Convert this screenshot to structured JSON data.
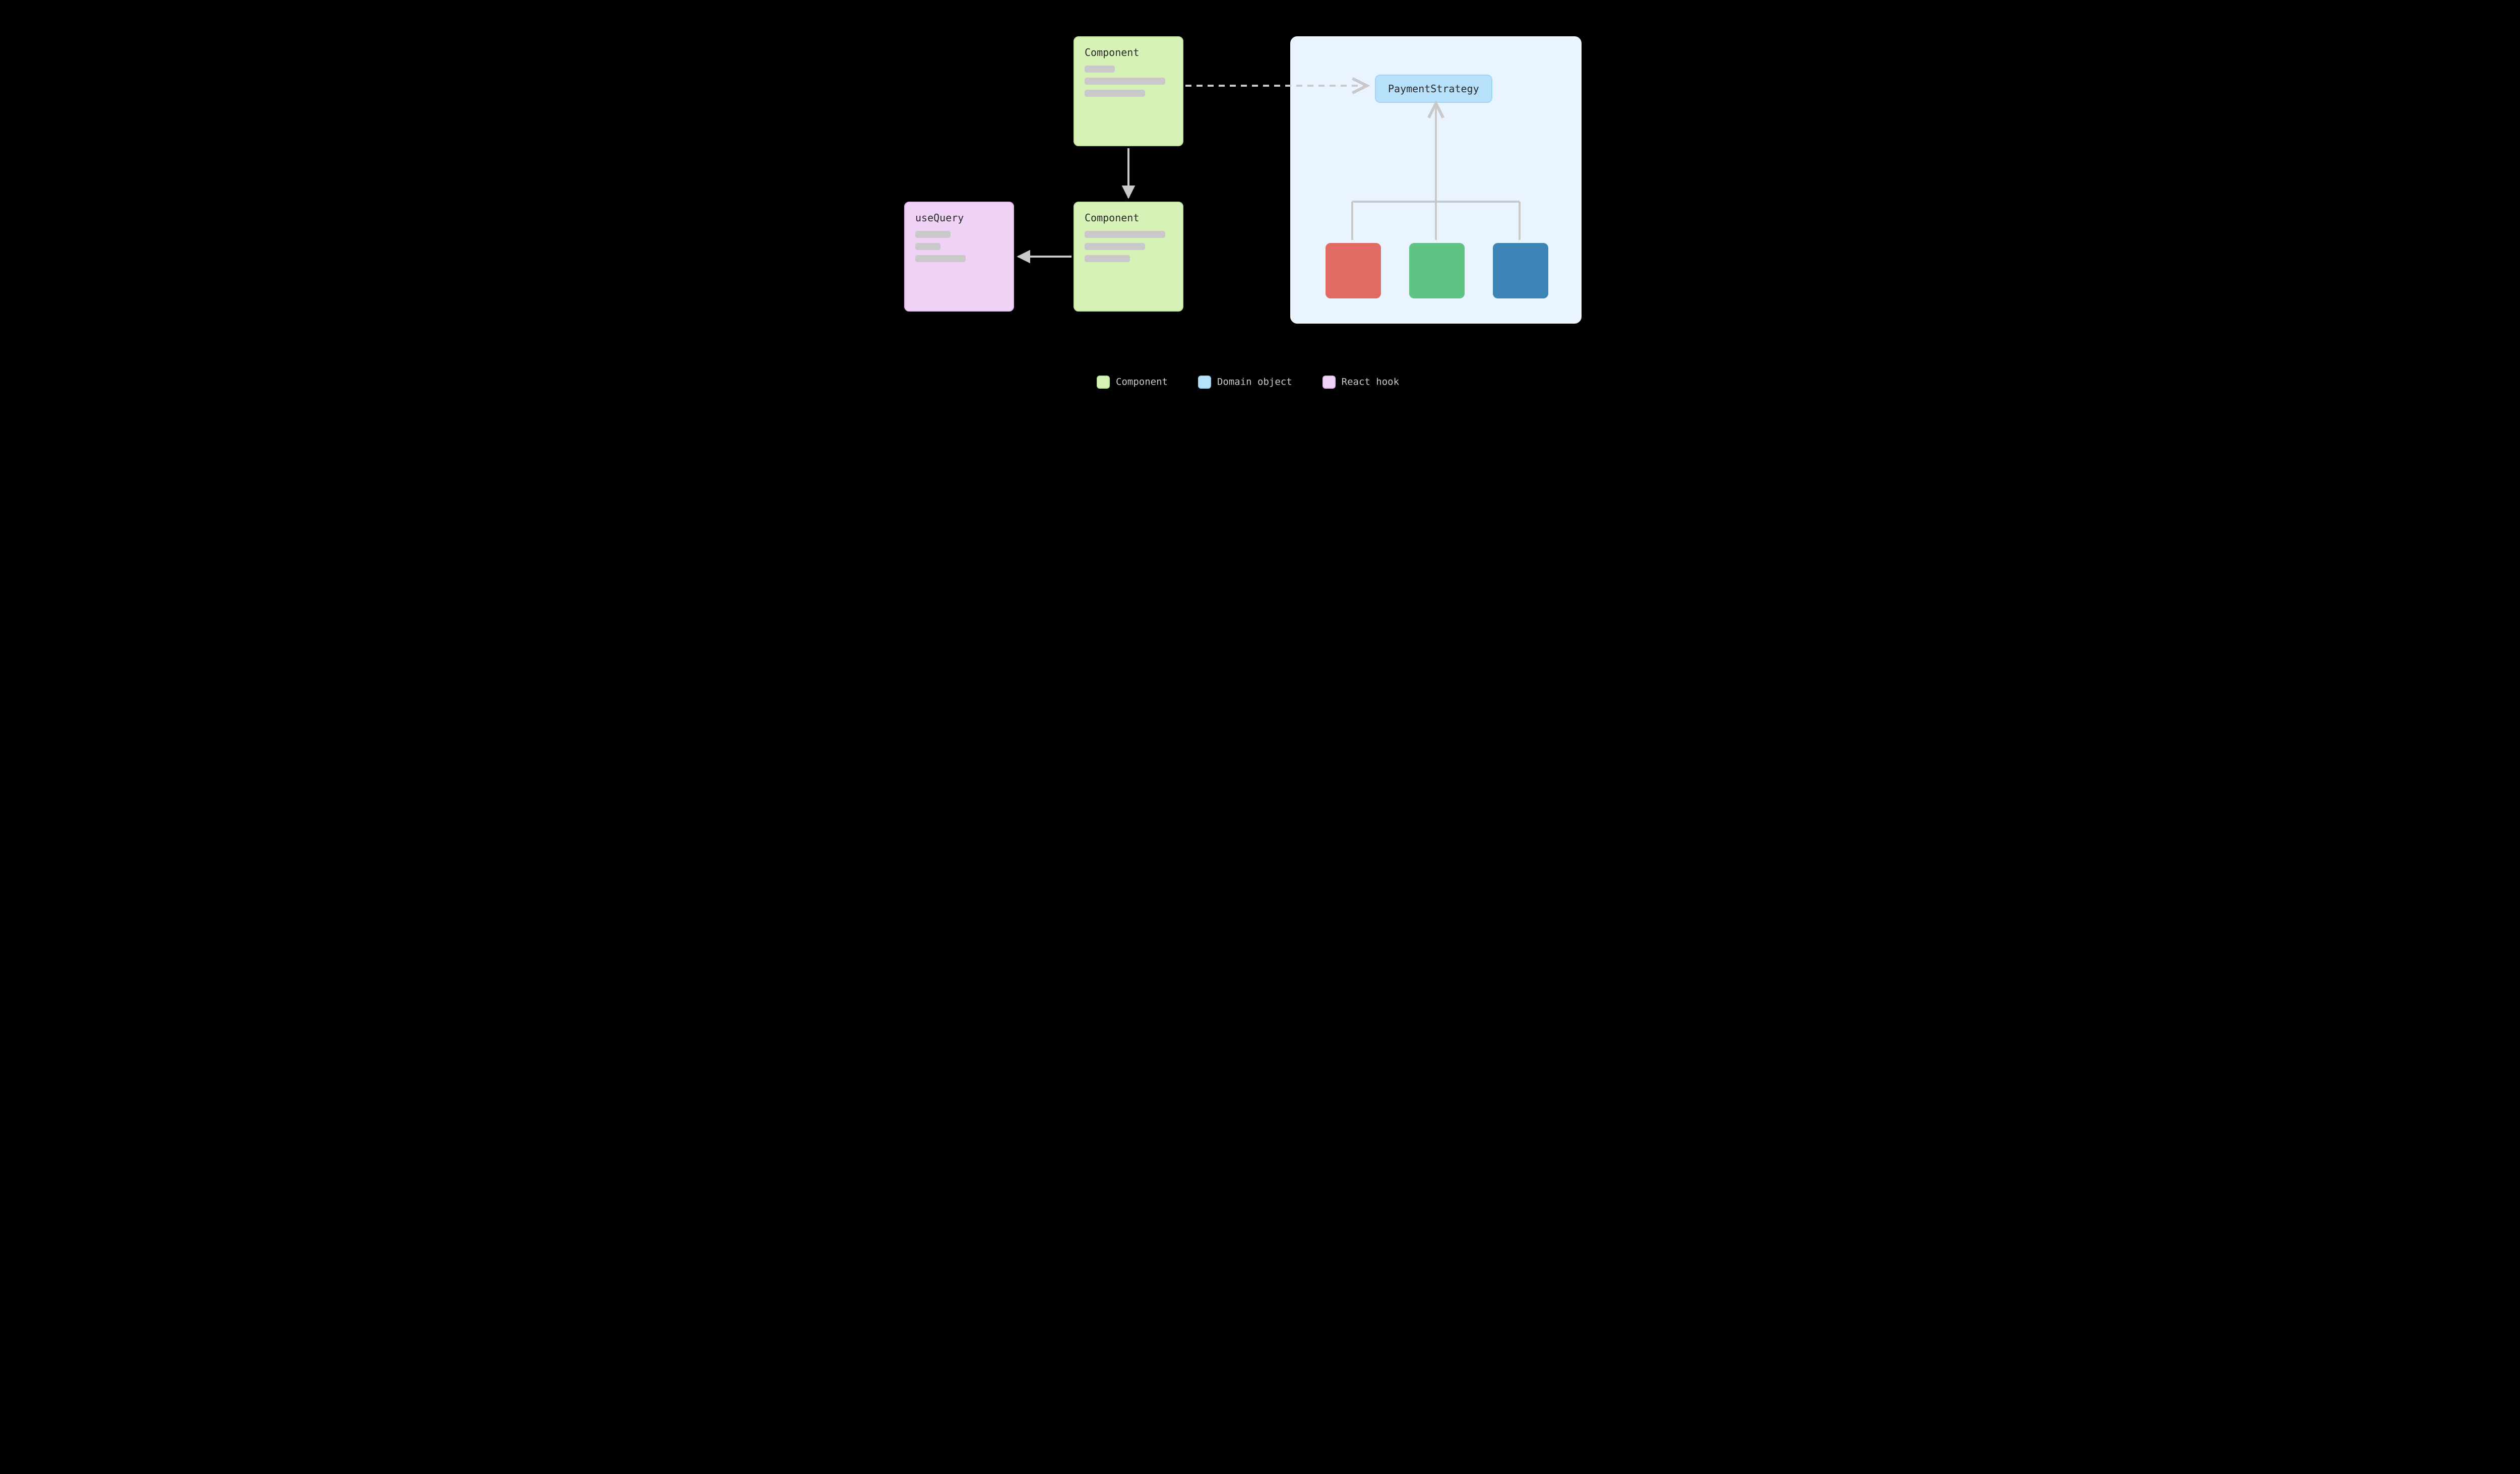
{
  "nodes": {
    "component_top": {
      "label": "Component"
    },
    "component_bottom": {
      "label": "Component"
    },
    "hook": {
      "label": "useQuery"
    },
    "domain_interface": {
      "label": "PaymentStrategy"
    }
  },
  "legend": {
    "component": "Component",
    "domain": "Domain object",
    "hook": "React hook"
  },
  "colors": {
    "component_bg": "#d6f2b6",
    "domain_bg": "#b7e0fb",
    "hook_bg": "#f0d2f7",
    "impl_red": "#e16a63",
    "impl_green": "#5ec383",
    "impl_blue": "#3b84b5",
    "panel_bg": "#eaf4ff",
    "arrow": "#c9c9c9"
  },
  "edges": [
    {
      "from": "component_top",
      "to": "domain_interface",
      "style": "dashed"
    },
    {
      "from": "component_top",
      "to": "component_bottom",
      "style": "solid"
    },
    {
      "from": "component_bottom",
      "to": "hook",
      "style": "solid"
    },
    {
      "from": "impl_red",
      "to": "domain_interface",
      "style": "solid"
    },
    {
      "from": "impl_green",
      "to": "domain_interface",
      "style": "solid"
    },
    {
      "from": "impl_blue",
      "to": "domain_interface",
      "style": "solid"
    }
  ]
}
